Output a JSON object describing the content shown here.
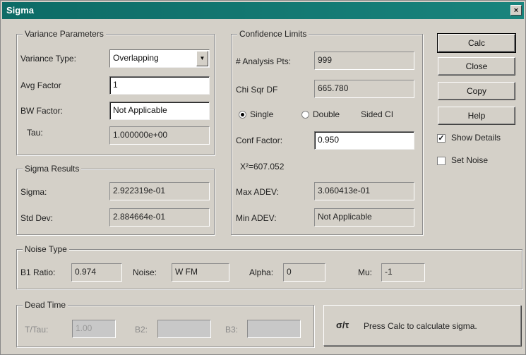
{
  "window": {
    "title": "Sigma",
    "close_glyph": "×"
  },
  "variance": {
    "legend": "Variance Parameters",
    "type_label": "Variance Type:",
    "type_value": "Overlapping",
    "avg_label": "Avg Factor",
    "avg_value": "1",
    "bw_label": "BW Factor:",
    "bw_value": "Not Applicable",
    "tau_label": "Tau:",
    "tau_value": "1.000000e+00"
  },
  "sigma_results": {
    "legend": "Sigma Results",
    "sigma_label": "Sigma:",
    "sigma_value": "2.922319e-01",
    "stddev_label": "Std Dev:",
    "stddev_value": "2.884664e-01"
  },
  "confidence": {
    "legend": "Confidence Limits",
    "analysis_label": "# Analysis Pts:",
    "analysis_value": "999",
    "chi_label": "Chi Sqr DF",
    "chi_value": "665.780",
    "single_label": "Single",
    "double_label": "Double",
    "sided_label": "Sided CI",
    "single_selected": true,
    "conf_label": "Conf Factor:",
    "conf_value": "0.950",
    "chi_result": "X²=607.052",
    "max_label": "Max ADEV:",
    "max_value": "3.060413e-01",
    "min_label": "Min ADEV:",
    "min_value": "Not Applicable"
  },
  "buttons": {
    "calc": "Calc",
    "close": "Close",
    "copy": "Copy",
    "help": "Help"
  },
  "options": {
    "show_details_label": "Show Details",
    "show_details_checked": true,
    "set_noise_label": "Set Noise",
    "set_noise_checked": false
  },
  "noise": {
    "legend": "Noise Type",
    "b1_label": "B1 Ratio:",
    "b1_value": "0.974",
    "noise_label": "Noise:",
    "noise_value": "W FM",
    "alpha_label": "Alpha:",
    "alpha_value": "0",
    "mu_label": "Mu:",
    "mu_value": "-1"
  },
  "dead_time": {
    "legend": "Dead Time",
    "ttau_label": "T/Tau:",
    "ttau_value": "1.00",
    "b2_label": "B2:",
    "b2_value": "",
    "b3_label": "B3:",
    "b3_value": ""
  },
  "status": {
    "icon": "σ/τ",
    "message": "Press Calc to calculate sigma."
  },
  "colors": {
    "titlebar": "#0d6b66",
    "face": "#d4d0c8"
  }
}
